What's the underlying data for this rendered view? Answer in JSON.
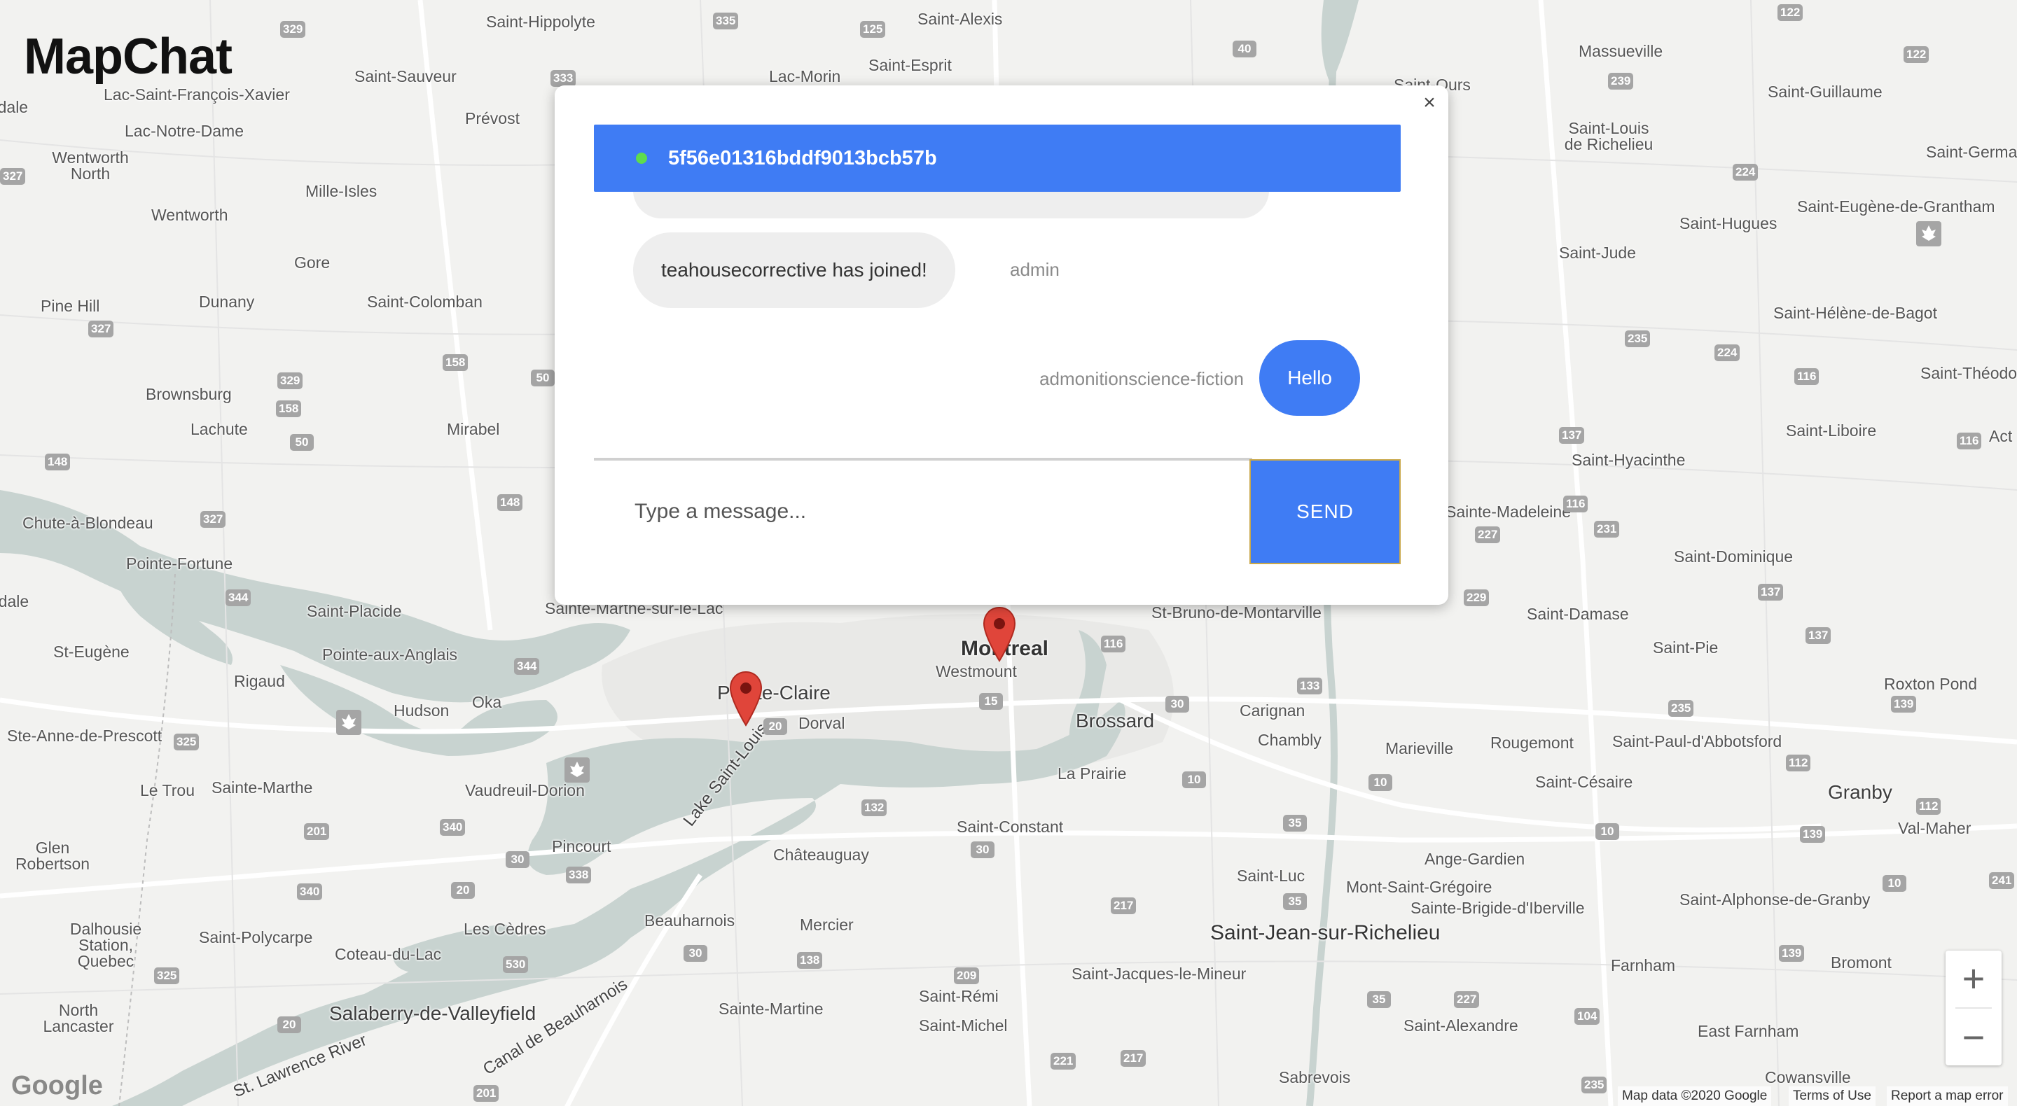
{
  "app": {
    "logo": "MapChat"
  },
  "chat": {
    "room_id": "5f56e01316bddf9013bcb57b",
    "close_label": "×",
    "messages": [
      {
        "text": "teahousecorrective has joined!",
        "sender": "admin",
        "side": "left"
      },
      {
        "text": "Hello",
        "sender": "admonitionscience-fiction",
        "side": "right"
      }
    ],
    "input_placeholder": "Type a message...",
    "input_value": "",
    "send_label": "SEND",
    "colors": {
      "header": "#3f7cf4",
      "online": "#5edc4c",
      "bubble_other": "#eeeeee"
    }
  },
  "map": {
    "places": [
      "Saint-Hippolyte",
      "Saint-Alexis",
      "Saint-Esprit",
      "Lac-Morin",
      "Saint-Ours",
      "Massueville",
      "Saint-Guillaume",
      "Saint-Sauveur",
      "Lac-Saint-François-Xavier",
      "Lac-Notre-Dame",
      "Prévost",
      "Wentworth North",
      "Wentworth",
      "Mille-Isles",
      "Saint-Louis de Richelieu",
      "Saint-Germain",
      "Saint-Eugène-de-Grantham",
      "Saint-Hugues",
      "Saint-Jude",
      "Gore",
      "Saint-Colomban",
      "Pine Hill",
      "Dunany",
      "Saint-Hélène-de-Bagot",
      "Saint-Théodore Quebec",
      "Brownsburg",
      "Lachute",
      "Mirabel",
      "Saint-Liboire",
      "Saint-Hyacinthe",
      "Sainte-Madeleine",
      "Chute-à-Blondeau",
      "Pointe-Fortune",
      "Saint-Dominique",
      "Saint-Placide",
      "Sainte-Marthe-sur-le-Lac",
      "St-Bruno-de-Montarville",
      "Saint-Damase",
      "Saint-Pie",
      "St-Eugène",
      "Pointe-aux-Anglais",
      "Rigaud",
      "Hudson",
      "Oka",
      "Pointe-Claire",
      "Dorval",
      "Westmount",
      "Montreal",
      "Brossard",
      "Carignan",
      "Chambly",
      "Marieville",
      "Rougemont",
      "Saint-Paul-d'Abbotsford",
      "Roxton Pond",
      "Ste-Anne-de-Prescott",
      "Le Trou",
      "Sainte-Marthe",
      "Vaudreuil-Dorion",
      "La Prairie",
      "Saint-Césaire",
      "Granby",
      "Val-Maher",
      "Glen Robertson",
      "Pincourt",
      "Lake Saint-Louis",
      "Châteauguay",
      "Saint-Constant",
      "Ange-Gardien",
      "Saint-Luc",
      "Mont-Saint-Grégoire",
      "Saint-Alphonse-de-Granby",
      "Sainte-Brigide-d'Iberville",
      "Dalhousie Station, Quebec",
      "Saint-Polycarpe",
      "Les Cèdres",
      "Beauharnois",
      "Mercier",
      "Coteau-du-Lac",
      "Saint-Jean-sur-Richelieu",
      "Farnham",
      "Bromont",
      "Saint-Jacques-le-Mineur",
      "North Lancaster",
      "Salaberry-de-Valleyfield",
      "Sainte-Martine",
      "Saint-Rémi",
      "Saint-Michel",
      "Saint-Alexandre",
      "East Farnham",
      "Canal de Beauharnois",
      "St. Lawrence River",
      "Sabrevois",
      "Cowansville",
      "Ndale",
      "rdale",
      "Act"
    ],
    "zoom_in_label": "+",
    "zoom_out_label": "−",
    "google_logo": "Google",
    "attribution": {
      "data": "Map data ©2020 Google",
      "terms": "Terms of Use",
      "report": "Report a map error"
    }
  }
}
